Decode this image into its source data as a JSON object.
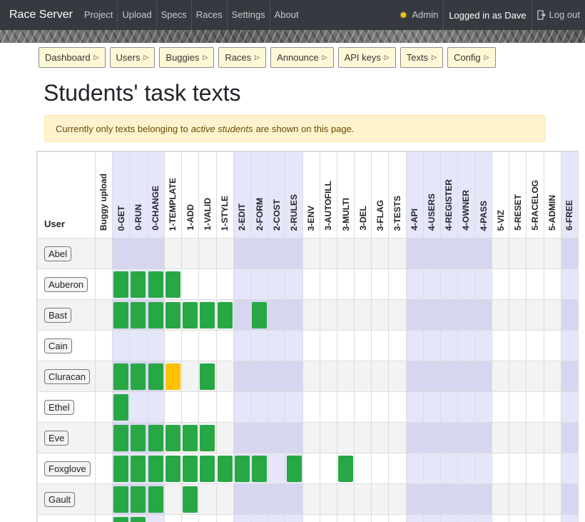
{
  "navbar": {
    "brand": "Race Server",
    "links": [
      "Project",
      "Upload",
      "Specs",
      "Races",
      "Settings",
      "About"
    ],
    "admin": "Admin",
    "logged_in": "Logged in as Dave",
    "logout": "Log out"
  },
  "admin_menu": [
    "Dashboard",
    "Users",
    "Buggies",
    "Races",
    "Announce",
    "API keys",
    "Texts",
    "Config"
  ],
  "page": {
    "title": "Students' task texts",
    "alert_before": "Currently only texts belonging to",
    "alert_em": "active students",
    "alert_after": "are shown on this page."
  },
  "table": {
    "user_header": "User",
    "columns": [
      {
        "label": "Buggy upload",
        "group": 0
      },
      {
        "label": "0-GET",
        "group": 1
      },
      {
        "label": "0-RUN",
        "group": 1
      },
      {
        "label": "0-CHANGE",
        "group": 1
      },
      {
        "label": "1-TEMPLATE",
        "group": 2
      },
      {
        "label": "1-ADD",
        "group": 2
      },
      {
        "label": "1-VALID",
        "group": 2
      },
      {
        "label": "1-STYLE",
        "group": 2
      },
      {
        "label": "2-EDIT",
        "group": 3
      },
      {
        "label": "2-FORM",
        "group": 3
      },
      {
        "label": "2-COST",
        "group": 3
      },
      {
        "label": "2-RULES",
        "group": 3
      },
      {
        "label": "3-ENV",
        "group": 4
      },
      {
        "label": "3-AUTOFILL",
        "group": 4
      },
      {
        "label": "3-MULTI",
        "group": 4
      },
      {
        "label": "3-DEL",
        "group": 4
      },
      {
        "label": "3-FLAG",
        "group": 4
      },
      {
        "label": "3-TESTS",
        "group": 4
      },
      {
        "label": "4-API",
        "group": 5
      },
      {
        "label": "4-USERS",
        "group": 5
      },
      {
        "label": "4-REGISTER",
        "group": 5
      },
      {
        "label": "4-OWNER",
        "group": 5
      },
      {
        "label": "4-PASS",
        "group": 5
      },
      {
        "label": "5-VIZ",
        "group": 6
      },
      {
        "label": "5-RESET",
        "group": 6
      },
      {
        "label": "5-RACELOG",
        "group": 6
      },
      {
        "label": "5-ADMIN",
        "group": 6
      },
      {
        "label": "6-FREE",
        "group": 7
      }
    ],
    "rows": [
      {
        "user": "Abel",
        "cells": "............................"
      },
      {
        "user": "Auberon",
        "cells": ".GGGG......................."
      },
      {
        "user": "Bast",
        "cells": ".GGGGGGG.G.................."
      },
      {
        "user": "Cain",
        "cells": "............................"
      },
      {
        "user": "Cluracan",
        "cells": ".GGGY.G....................."
      },
      {
        "user": "Ethel",
        "cells": ".G.........................."
      },
      {
        "user": "Eve",
        "cells": ".GGGGGG....................."
      },
      {
        "user": "Foxglove",
        "cells": ".GGGGGGGGG.G..G............."
      },
      {
        "user": "Gault",
        "cells": ".GGG.G......................"
      },
      {
        "user": "",
        "cells": ".GG........................."
      }
    ]
  },
  "colors": {
    "green": "#28a745",
    "yellow": "#ffc107",
    "group_tint": "#e6e6fa",
    "group_tint_odd_row": "#d6d6f0"
  }
}
